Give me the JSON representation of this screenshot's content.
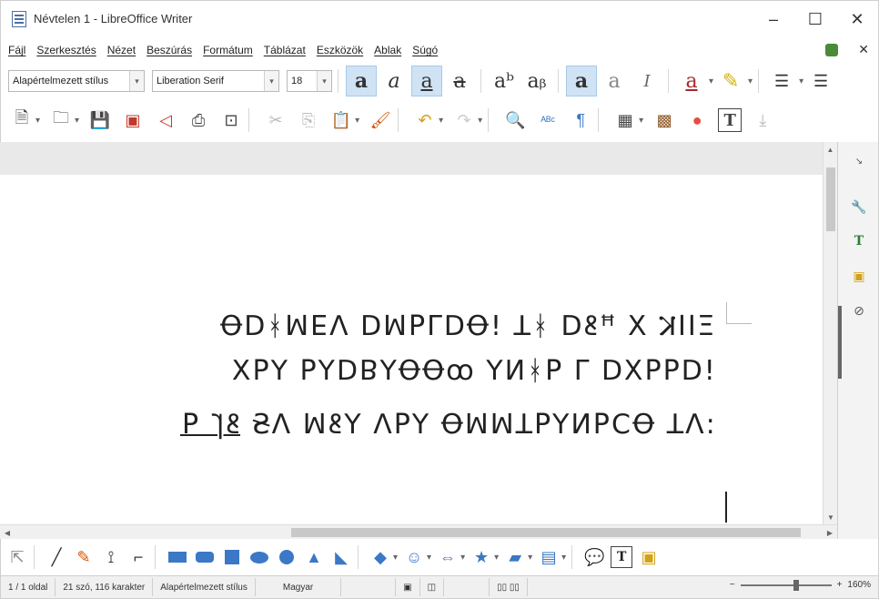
{
  "window": {
    "title": "Névtelen 1 - LibreOffice Writer",
    "minimize_glyph": "–",
    "maximize_glyph": "☐",
    "close_glyph": "✕"
  },
  "menubar": {
    "items": [
      {
        "label": "Fájl"
      },
      {
        "label": "Szerkesztés"
      },
      {
        "label": "Nézet"
      },
      {
        "label": "Beszúrás"
      },
      {
        "label": "Formátum"
      },
      {
        "label": "Táblázat"
      },
      {
        "label": "Eszközök"
      },
      {
        "label": "Ablak"
      },
      {
        "label": "Súgó"
      }
    ],
    "close_doc_glyph": "✕"
  },
  "format_toolbar": {
    "paragraph_style": "Alapértelmezett stílus",
    "font_name": "Liberation Serif",
    "font_size": "18",
    "dropdown_glyph": "▾",
    "buttons": [
      {
        "name": "bold-button",
        "glyph": "a",
        "active": true
      },
      {
        "name": "italic-button",
        "glyph": "a",
        "active": false
      },
      {
        "name": "underline-button",
        "glyph": "a",
        "active": true
      },
      {
        "name": "strikethrough-button",
        "glyph": "a",
        "active": false
      },
      {
        "name": "superscript-button",
        "glyph": "aᵇ",
        "active": false
      },
      {
        "name": "subscript-button",
        "glyph": "aᵦ",
        "active": false
      },
      {
        "name": "shadow-button",
        "glyph": "a",
        "active": true
      },
      {
        "name": "outline-button",
        "glyph": "a",
        "active": false
      },
      {
        "name": "clear-formatting-button",
        "glyph": "I",
        "active": false
      }
    ]
  },
  "document": {
    "line1": "ΞIIⲔ ⵝ ꟸꝸꓷ ᚼꓕ !Ꝋꓷꓶꟼꟽꓷ ꓥꓱꟽᚼꓷꝊ",
    "line2": "!ꓷꟼꟼꓫꓷ ꓶ ꟼᚼꓠꓬ ꝏꝊꝊꓬꓭꓷꓬꟼ ꓬꟼꓫ",
    "line3_main": ":ꓥꓕ ꝊꓛꟼꓠꓬꟼꓕꟽꟽꝊ ꓬꟼꓥ ꓬꝸꟽ ꓥꞨ",
    "line3_underlined": "ꝸꞄ ꟼ"
  },
  "statusbar": {
    "page": "1 / 1 oldal",
    "words": "21 szó, 116 karakter",
    "style": "Alapértelmezett stílus",
    "language": "Magyar",
    "zoom_minus": "−",
    "zoom_plus": "+",
    "zoom_percent": "160%",
    "zoom_level_fraction": 0.6
  },
  "colors": {
    "accent_blue": "#3b78c6",
    "active_button_bg": "#cfe3f5",
    "ruler_grey": "#e9e9e9",
    "shape_blue": "#3b78c6"
  }
}
